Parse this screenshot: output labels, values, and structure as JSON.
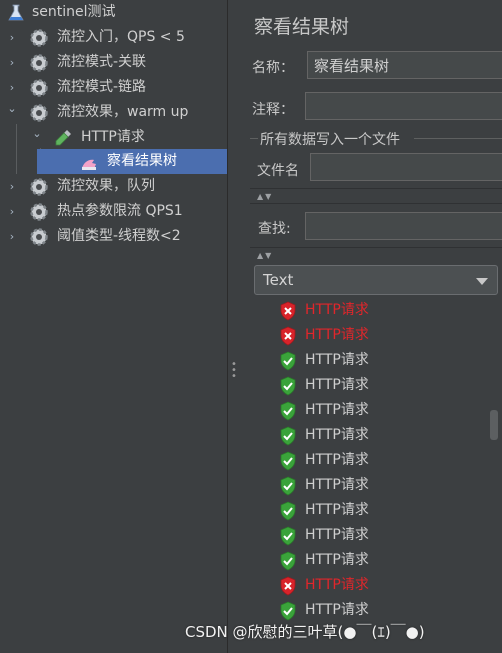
{
  "tree": {
    "items": [
      {
        "label": "sentinel测试",
        "icon": "flask-icon",
        "arrow": ""
      },
      {
        "label": "流控入门，QPS < 5",
        "icon": "gear-icon",
        "arrow": "›"
      },
      {
        "label": "流控模式-关联",
        "icon": "gear-icon",
        "arrow": "›"
      },
      {
        "label": "流控模式-链路",
        "icon": "gear-icon",
        "arrow": "›"
      },
      {
        "label": "流控效果，warm up",
        "icon": "gear-icon",
        "arrow": "⌄"
      },
      {
        "label": "HTTP请求",
        "icon": "pipette-icon",
        "arrow": "⌄"
      },
      {
        "label": "察看结果树",
        "icon": "listener-icon",
        "arrow": ""
      },
      {
        "label": "流控效果，队列",
        "icon": "gear-icon",
        "arrow": "›"
      },
      {
        "label": "热点参数限流 QPS1",
        "icon": "gear-icon",
        "arrow": "›"
      },
      {
        "label": "阈值类型-线程数<2",
        "icon": "gear-icon",
        "arrow": "›"
      }
    ]
  },
  "panel": {
    "title": "察看结果树",
    "name_label": "名称：",
    "name_value": "察看结果树",
    "comment_label": "注释：",
    "comment_value": "",
    "file_group_label": "所有数据写入一个文件",
    "filename_label": "文件名",
    "filename_value": "",
    "search_label": "查找:",
    "search_value": "",
    "mode_selected": "Text"
  },
  "results": [
    {
      "label": "HTTP请求",
      "status": "fail"
    },
    {
      "label": "HTTP请求",
      "status": "fail"
    },
    {
      "label": "HTTP请求",
      "status": "ok"
    },
    {
      "label": "HTTP请求",
      "status": "ok"
    },
    {
      "label": "HTTP请求",
      "status": "ok"
    },
    {
      "label": "HTTP请求",
      "status": "ok"
    },
    {
      "label": "HTTP请求",
      "status": "ok"
    },
    {
      "label": "HTTP请求",
      "status": "ok"
    },
    {
      "label": "HTTP请求",
      "status": "ok"
    },
    {
      "label": "HTTP请求",
      "status": "ok"
    },
    {
      "label": "HTTP请求",
      "status": "ok"
    },
    {
      "label": "HTTP请求",
      "status": "fail"
    },
    {
      "label": "HTTP请求",
      "status": "ok"
    }
  ],
  "watermark": "CSDN @欣慰的三叶草(●￣(ｴ)￣●)",
  "colors": {
    "selection": "#4b6eaf",
    "ok": "#3aa33a",
    "fail": "#d8232a",
    "fail_text": "#e0262b"
  }
}
